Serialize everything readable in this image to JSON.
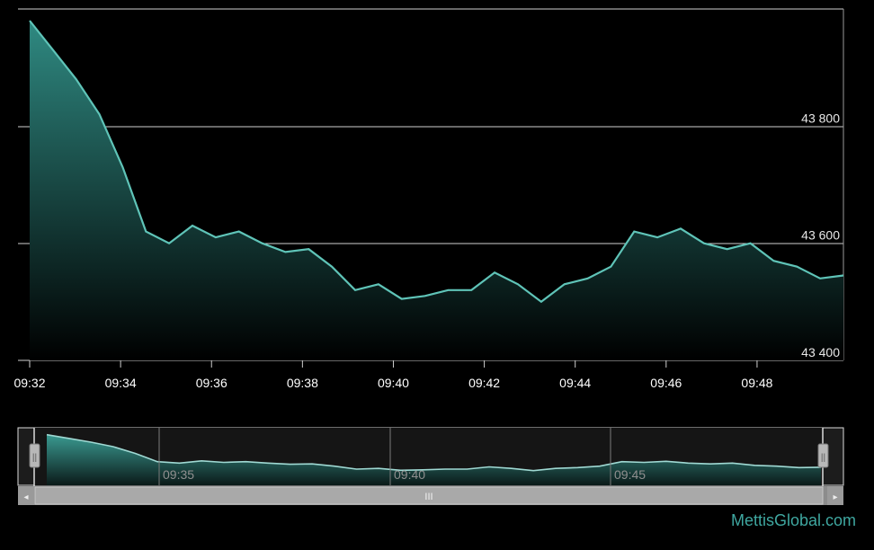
{
  "chart_data": {
    "type": "area",
    "x": [
      "09:32",
      "09:32",
      "09:33",
      "09:33",
      "09:34",
      "09:34",
      "09:35",
      "09:35",
      "09:36",
      "09:36",
      "09:37",
      "09:37",
      "09:38",
      "09:38",
      "09:39",
      "09:39",
      "09:40",
      "09:40",
      "09:41",
      "09:41",
      "09:42",
      "09:42",
      "09:43",
      "09:43",
      "09:44",
      "09:44",
      "09:45",
      "09:45",
      "09:46",
      "09:46",
      "09:47",
      "09:47",
      "09:48",
      "09:48",
      "09:49",
      "09:49"
    ],
    "values": [
      43980,
      43930,
      43880,
      43820,
      43730,
      43620,
      43600,
      43630,
      43610,
      43620,
      43600,
      43585,
      43590,
      43560,
      43520,
      43530,
      43505,
      43510,
      43520,
      43520,
      43550,
      43530,
      43500,
      43530,
      43540,
      43560,
      43620,
      43610,
      43625,
      43600,
      43590,
      43600,
      43570,
      43560,
      43540,
      43545
    ],
    "series_points": [
      [
        "09:32:00",
        43980
      ],
      [
        "09:32:30",
        43930
      ],
      [
        "09:33:00",
        43880
      ],
      [
        "09:33:30",
        43820
      ],
      [
        "09:34:00",
        43730
      ],
      [
        "09:34:30",
        43620
      ]
    ],
    "ylim": [
      43400,
      44000
    ],
    "yticks": [
      "43 400",
      "43 600",
      "43 800"
    ],
    "xticks": [
      "09:32",
      "09:34",
      "09:36",
      "09:38",
      "09:40",
      "09:42",
      "09:44",
      "09:46",
      "09:48"
    ],
    "grid": true,
    "line_color": "#5fc4b8",
    "fill_top_color": "#2f8a82"
  },
  "navigator": {
    "ticks": [
      "09:35",
      "09:40",
      "09:45"
    ],
    "scroll_grip": "III",
    "left_arrow": "◂",
    "right_arrow": "▸",
    "handle_grip": "||"
  },
  "brand": "MettisGlobal.com"
}
